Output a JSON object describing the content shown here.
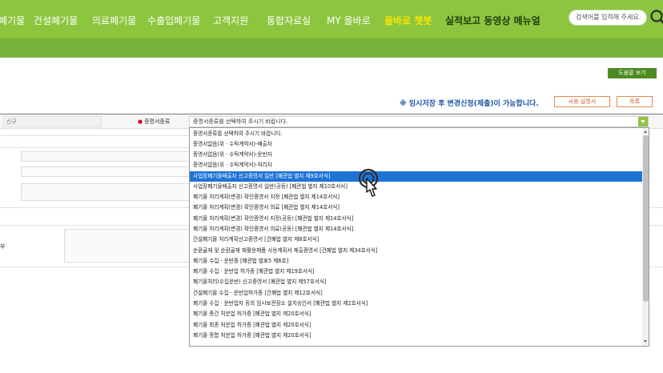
{
  "nav": {
    "items": [
      {
        "label": "폐기물"
      },
      {
        "label": "건설폐기물"
      },
      {
        "label": "의료폐기물"
      },
      {
        "label": "수출입폐기물"
      },
      {
        "label": "고객지원"
      },
      {
        "label": "통합자료실"
      },
      {
        "label": "MY 올바로"
      },
      {
        "label": "올바로 챗봇"
      },
      {
        "label": "실적보고 동영상 메뉴얼"
      }
    ],
    "search_placeholder": "검색어를 입력해 주세요.",
    "search_icon": "search-icon",
    "colors": {
      "nav_bg": "#8cc63f",
      "active": "#ffe500",
      "subbar": "#79b33a"
    }
  },
  "help_button": "도움말 보기",
  "notice": "※ 임시저장 후 변경신청(제출)이 가능합니다.",
  "guide_button": "사용 설명서",
  "list_button": "목록",
  "form": {
    "new_label": "신규",
    "type_label": "증명서종류",
    "select_value": "증명서종류를 선택하여 주시기 바랍니다.",
    "left_label": "부"
  },
  "dropdown": {
    "selected_index": 4,
    "options": [
      "증명서종류를 선택하여 주시기 바랍니다.",
      "증명서없음(위 · 수탁계약서)-배출자",
      "증명서없음(위 · 수탁계약서)-운반자",
      "증명서없음(위 · 수탁계약서)-처리자",
      "사업장폐기물배출자 신고증명서 일반 [폐관법 별지 제9호서식]",
      "사업장폐기물배출자 신고증명서 일반(공동) [폐관법 별지 제10호서식]",
      "폐기물 처리계획(변경) 확인증명서 지정 [폐관법 별지 제14호서식]",
      "폐기물 처리계획(변경) 확인증명서 의료 [폐관법 별지 제14호서식]",
      "폐기물 처리계획(변경) 확인증명서 지정(공동) [폐관법 별지 제14호서식]",
      "폐기물 처리계획(변경) 확인증명서 의료(공동) [폐관법 별지 제14호서식]",
      "건설폐기물 처리계획신고증명서 [건폐법 별지 제8호서식]",
      "순환골재 및 순환골재 재활용제품 사용계획서 제출증명서 [건폐법 별지 제34호서식]",
      "폐기물 수집 · 운반증 [폐관법 별표5 제6호]",
      "폐기물 수집 · 운반업 허가증 [폐관법 별지 제19호서식]",
      "폐기물처리(수집운반) 신고증명서 [폐관법 별지 제57호서식]",
      "건설폐기물 수집 · 운반업허가증 [건폐법 별지 제12호서식]",
      "폐기물 수집 · 운반업자 등의 임시보관장소 설치승인서 [폐관법 별지 제2호서식]",
      "폐기물 중간 처분업 허가증 [폐관법 별지 제20호서식]",
      "폐기물 최종 처분업 허가증 [폐관법 별지 제20호서식]",
      "폐기물 종합 처분업 허가증 [폐관법 별지 제20호서식]"
    ]
  },
  "cursor_icon": "hand-pointer-icon"
}
